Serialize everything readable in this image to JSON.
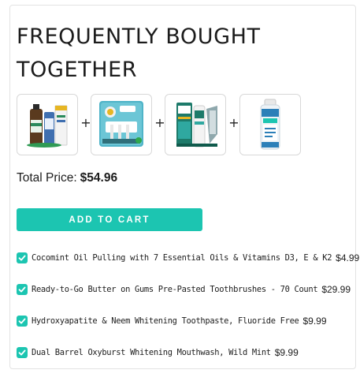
{
  "section": {
    "title": "FREQUENTLY BOUGHT TOGETHER"
  },
  "products": [
    {
      "icon": "oil-bottle-image",
      "accent": "#2a8a5c"
    },
    {
      "icon": "toothbrush-pack-image",
      "accent": "#2fa8a0"
    },
    {
      "icon": "toothpaste-image",
      "accent": "#1d7a6a"
    },
    {
      "icon": "mouthwash-bottle-image",
      "accent": "#2b7fb8"
    }
  ],
  "plus_symbol": "+",
  "total": {
    "label": "Total Price:",
    "amount": "$54.96"
  },
  "cart_button": {
    "label": "ADD TO CART"
  },
  "items": [
    {
      "name": "Cocomint Oil Pulling with 7 Essential Oils & Vitamins D3, E & K2",
      "price": "$4.99",
      "checked": true
    },
    {
      "name": "Ready-to-Go Butter on Gums Pre-Pasted Toothbrushes - 70 Count",
      "price": "$29.99",
      "checked": true
    },
    {
      "name": "Hydroxyapatite & Neem Whitening Toothpaste, Fluoride Free",
      "price": "$9.99",
      "checked": true
    },
    {
      "name": "Dual Barrel Oxyburst Whitening Mouthwash, Wild Mint",
      "price": "$9.99",
      "checked": true
    }
  ],
  "colors": {
    "accent": "#1cc5b1",
    "text": "#1c1c1c",
    "border": "#e3e3e3"
  }
}
